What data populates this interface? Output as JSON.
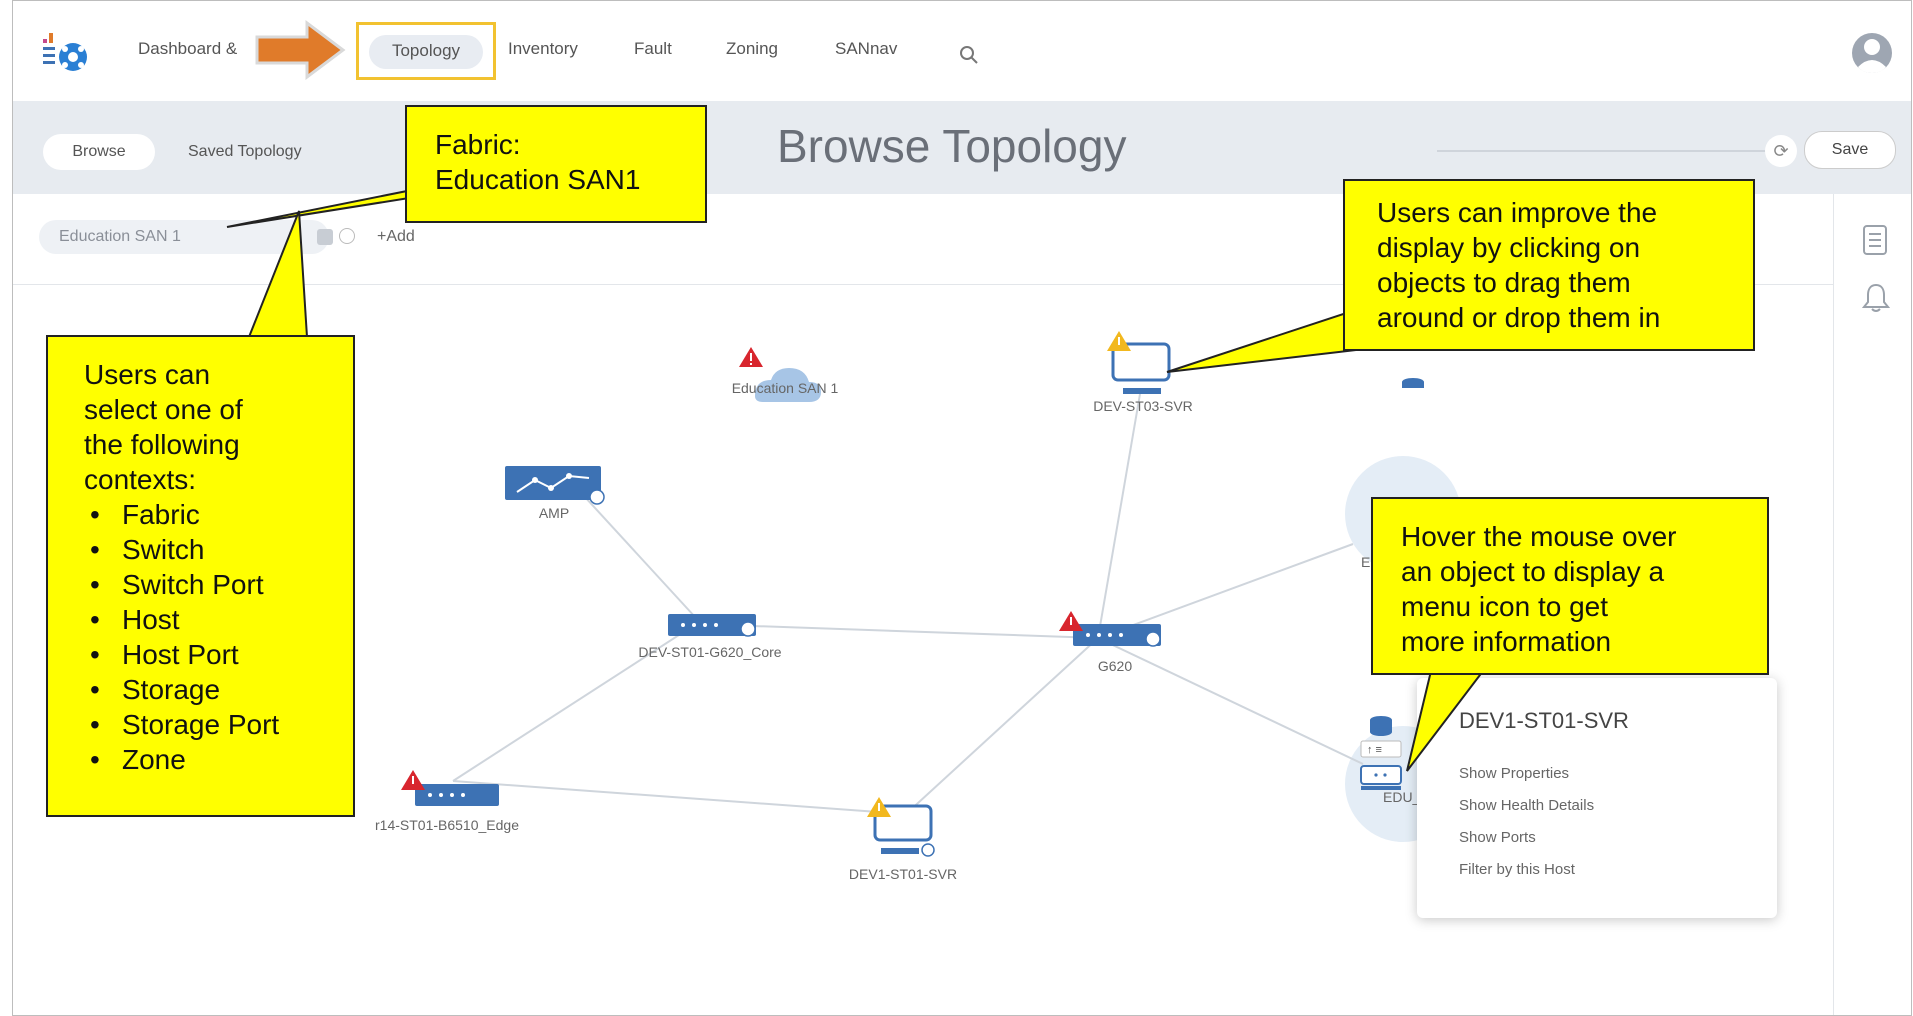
{
  "nav": {
    "items": [
      "Dashboard &",
      "Topology",
      "Inventory",
      "Fault",
      "Zoning",
      "SANnav"
    ],
    "active": "Topology"
  },
  "toolbar": {
    "browse_label": "Browse",
    "saved_topology_label": "Saved Topology",
    "page_title": "Browse Topology",
    "save_label": "Save"
  },
  "filter": {
    "context_value": "Education SAN 1",
    "add_label": "+Add"
  },
  "nodes": {
    "cloud": "Education SAN 1",
    "amp": "AMP",
    "server_top": "DEV-ST03-SVR",
    "core": "DEV-ST01-G620_Core",
    "g620": "G620",
    "edge": "r14-ST01-B6510_Edge",
    "server_bottom": "DEV1-ST01-SVR",
    "target_partial": "EDU_Targe",
    "edc_partial": "ED"
  },
  "context_menu": {
    "title": "DEV1-ST01-SVR",
    "items": [
      "Show Properties",
      "Show Health Details",
      "Show Ports",
      "Filter by this Host"
    ]
  },
  "callouts": {
    "fabric": {
      "line1": "Fabric:",
      "line2": "Education SAN1"
    },
    "contexts": {
      "intro": [
        "Users can",
        "select one of",
        "the following",
        "contexts:"
      ],
      "items": [
        "Fabric",
        "Switch",
        "Switch Port",
        "Host",
        "Host Port",
        "Storage",
        "Storage Port",
        "Zone"
      ]
    },
    "drag": {
      "lines": [
        "Users can improve the",
        "display by clicking on",
        "objects to drag them",
        "around or drop them in"
      ]
    },
    "hover": {
      "lines": [
        "Hover the mouse over",
        "an object to display a",
        "menu icon to get",
        "more information"
      ]
    }
  },
  "colors": {
    "callout_fill": "#ffff00",
    "arrow": "#e07b2a",
    "switch_blue": "#3d72b4",
    "alert_red": "#d8262e",
    "warn_yellow": "#f2b81e"
  }
}
